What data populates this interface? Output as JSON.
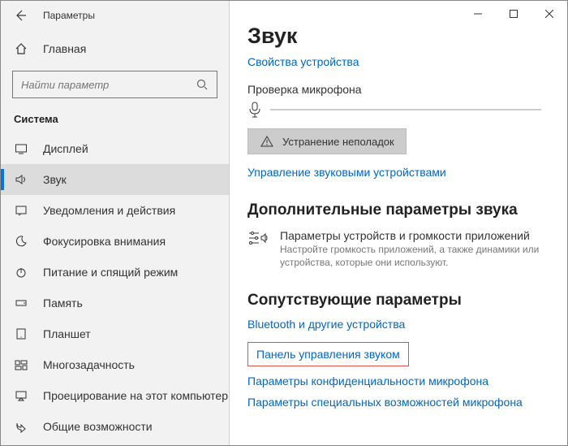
{
  "app_title": "Параметры",
  "home_label": "Главная",
  "search_placeholder": "Найти параметр",
  "section_title": "Система",
  "nav": [
    {
      "label": "Дисплей"
    },
    {
      "label": "Звук"
    },
    {
      "label": "Уведомления и действия"
    },
    {
      "label": "Фокусировка внимания"
    },
    {
      "label": "Питание и спящий режим"
    },
    {
      "label": "Память"
    },
    {
      "label": "Планшет"
    },
    {
      "label": "Многозадачность"
    },
    {
      "label": "Проецирование на этот компьютер"
    },
    {
      "label": "Общие возможности"
    }
  ],
  "main": {
    "heading": "Звук",
    "device_props_link": "Свойства устройства",
    "mic_test_label": "Проверка микрофона",
    "troubleshoot_btn": "Устранение неполадок",
    "manage_devices_link": "Управление звуковыми устройствами",
    "advanced_heading": "Дополнительные параметры звука",
    "app_volume_title": "Параметры устройств и громкости приложений",
    "app_volume_desc": "Настройте громкость приложений, а также динамики или устройства, которые они используют.",
    "related_heading": "Сопутствующие параметры",
    "related_links": {
      "bluetooth": "Bluetooth и другие устройства",
      "sound_panel": "Панель управления звуком",
      "mic_privacy": "Параметры конфиденциальности микрофона",
      "mic_access": "Параметры специальных возможностей микрофона"
    }
  }
}
